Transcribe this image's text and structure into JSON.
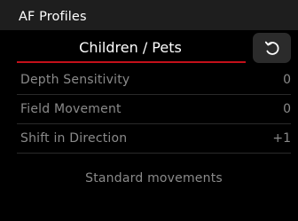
{
  "header": {
    "title": "AF Profiles"
  },
  "profile": {
    "name": "Children / Pets",
    "accent_color": "#c4101a"
  },
  "reset": {
    "icon": "reset-arrow-icon"
  },
  "settings": [
    {
      "label": "Depth Sensitivity",
      "value": "0"
    },
    {
      "label": "Field Movement",
      "value": "0"
    },
    {
      "label": "Shift in Direction",
      "value": "+1"
    }
  ],
  "preset": {
    "label": "Standard movements"
  }
}
